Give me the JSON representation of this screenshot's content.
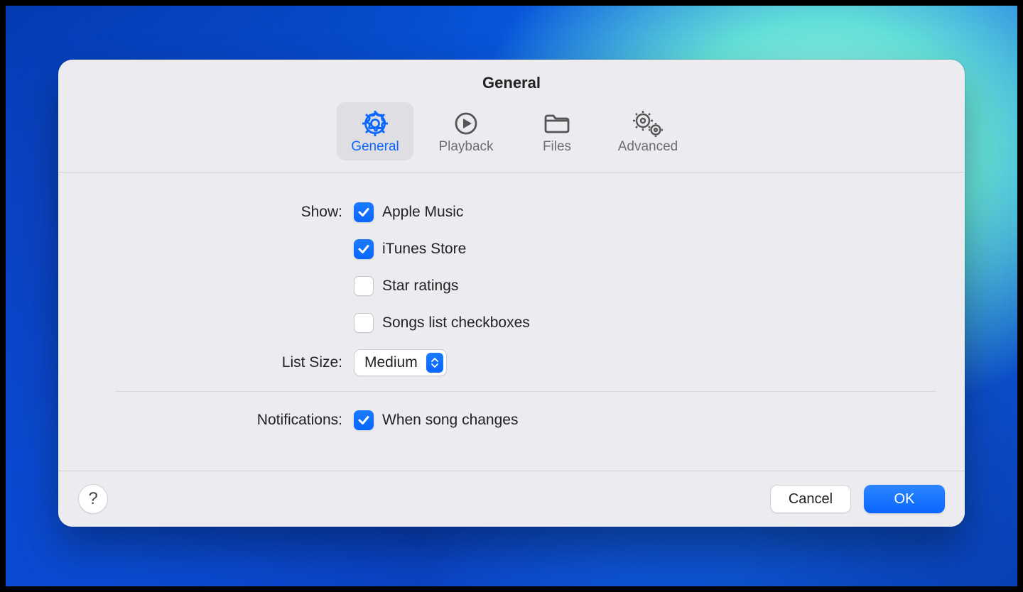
{
  "window": {
    "title": "General"
  },
  "tabs": {
    "general": {
      "label": "General"
    },
    "playback": {
      "label": "Playback"
    },
    "files": {
      "label": "Files"
    },
    "advanced": {
      "label": "Advanced"
    }
  },
  "labels": {
    "show": "Show:",
    "listSize": "List Size:",
    "notifications": "Notifications:"
  },
  "options": {
    "appleMusic": {
      "label": "Apple Music",
      "checked": true
    },
    "itunesStore": {
      "label": "iTunes Store",
      "checked": true
    },
    "starRatings": {
      "label": "Star ratings",
      "checked": false
    },
    "songsCheckboxes": {
      "label": "Songs list checkboxes",
      "checked": false
    },
    "whenSongChanges": {
      "label": "When song changes",
      "checked": true
    }
  },
  "listSize": {
    "value": "Medium"
  },
  "buttons": {
    "help": "?",
    "cancel": "Cancel",
    "ok": "OK"
  }
}
